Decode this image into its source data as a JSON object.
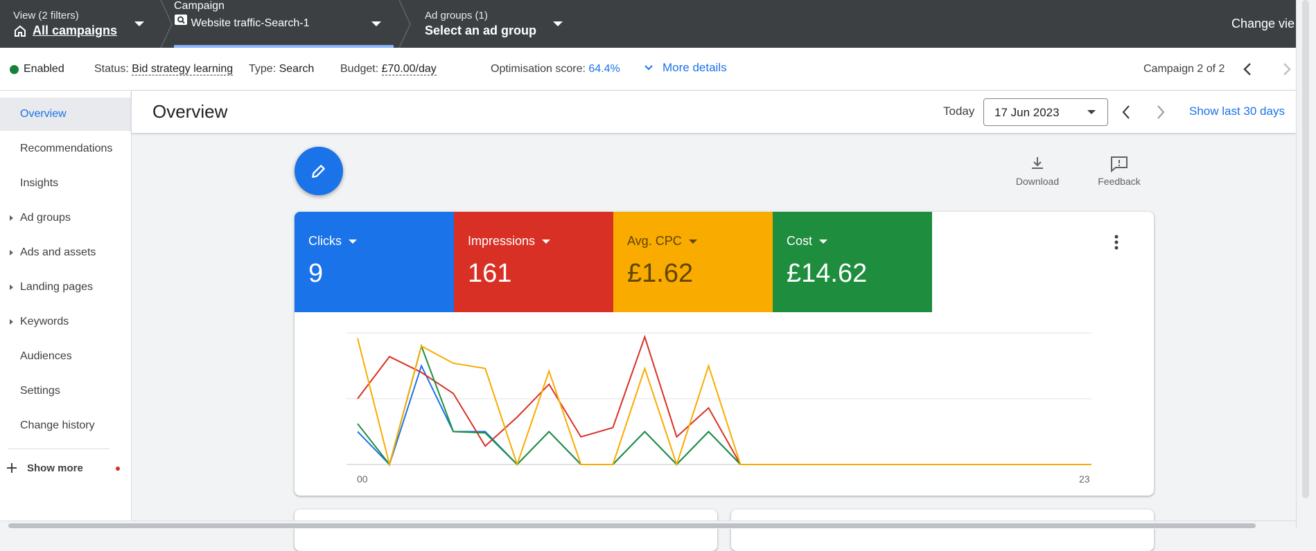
{
  "topbar": {
    "view": {
      "small": "View (2 filters)",
      "big": "All campaigns"
    },
    "campaign": {
      "small": "Campaign",
      "big": "Website traffic-Search-1"
    },
    "adgroup": {
      "small": "Ad groups (1)",
      "big": "Select an ad group"
    },
    "change_view": "Change vie"
  },
  "status_bar": {
    "enabled": "Enabled",
    "status_label": "Status:",
    "status_value": "Bid strategy learning",
    "type_label": "Type:",
    "type_value": "Search",
    "budget_label": "Budget:",
    "budget_value": "£70.00/day",
    "optimisation_label": "Optimisation score:",
    "optimisation_value": "64.4%",
    "more_details": "More details",
    "campaign_position": "Campaign 2 of 2"
  },
  "sidebar": {
    "items": [
      {
        "label": "Overview",
        "active": true,
        "expandable": false
      },
      {
        "label": "Recommendations",
        "active": false,
        "expandable": false
      },
      {
        "label": "Insights",
        "active": false,
        "expandable": false
      },
      {
        "label": "Ad groups",
        "active": false,
        "expandable": true
      },
      {
        "label": "Ads and assets",
        "active": false,
        "expandable": true
      },
      {
        "label": "Landing pages",
        "active": false,
        "expandable": true
      },
      {
        "label": "Keywords",
        "active": false,
        "expandable": true
      },
      {
        "label": "Audiences",
        "active": false,
        "expandable": false
      },
      {
        "label": "Settings",
        "active": false,
        "expandable": false
      },
      {
        "label": "Change history",
        "active": false,
        "expandable": false
      }
    ],
    "show_more": "Show more"
  },
  "header": {
    "title": "Overview",
    "today": "Today",
    "date": "17 Jun 2023",
    "show_last": "Show last 30 days"
  },
  "toolbar": {
    "download": "Download",
    "feedback": "Feedback"
  },
  "metrics": [
    {
      "label": "Clicks",
      "value": "9",
      "color": "#1a73e8"
    },
    {
      "label": "Impressions",
      "value": "161",
      "color": "#d93025"
    },
    {
      "label": "Avg. CPC",
      "value": "£1.62",
      "color": "#f9ab00"
    },
    {
      "label": "Cost",
      "value": "£14.62",
      "color": "#1e8e3e"
    }
  ],
  "chart": {
    "x_start": "00",
    "x_end": "23"
  },
  "chart_data": {
    "type": "line",
    "x": [
      0,
      1,
      2,
      3,
      4,
      5,
      6,
      7,
      8,
      9,
      10,
      11,
      12,
      13,
      14,
      15,
      16,
      17,
      18,
      19,
      20,
      21,
      22,
      23
    ],
    "series": [
      {
        "color": "#1a73e8",
        "values": [
          0.25,
          0,
          0.75,
          0.25,
          0.25,
          0,
          0.25,
          0,
          0,
          0.25,
          0,
          0.25,
          0,
          0,
          0,
          0,
          0,
          0,
          0,
          0,
          0,
          0,
          0,
          0
        ]
      },
      {
        "color": "#d93025",
        "values": [
          0.5,
          0.82,
          0.7,
          0.54,
          0.14,
          0.36,
          0.61,
          0.21,
          0.28,
          0.97,
          0.21,
          0.43,
          0,
          0,
          0,
          0,
          0,
          0,
          0,
          0,
          0,
          0,
          0,
          0
        ]
      },
      {
        "color": "#1e8e3e",
        "values": [
          0.31,
          0,
          0.9,
          0.25,
          0.24,
          0,
          0.25,
          0,
          0,
          0.25,
          0,
          0.25,
          0,
          0,
          0,
          0,
          0,
          0,
          0,
          0,
          0,
          0,
          0,
          0
        ]
      },
      {
        "color": "#f9ab00",
        "values": [
          0.96,
          0,
          0.9,
          0.77,
          0.73,
          0,
          0.71,
          0,
          0,
          0.73,
          0,
          0.75,
          0,
          0,
          0,
          0,
          0,
          0,
          0,
          0,
          0,
          0,
          0,
          0
        ]
      }
    ],
    "grid": true
  }
}
